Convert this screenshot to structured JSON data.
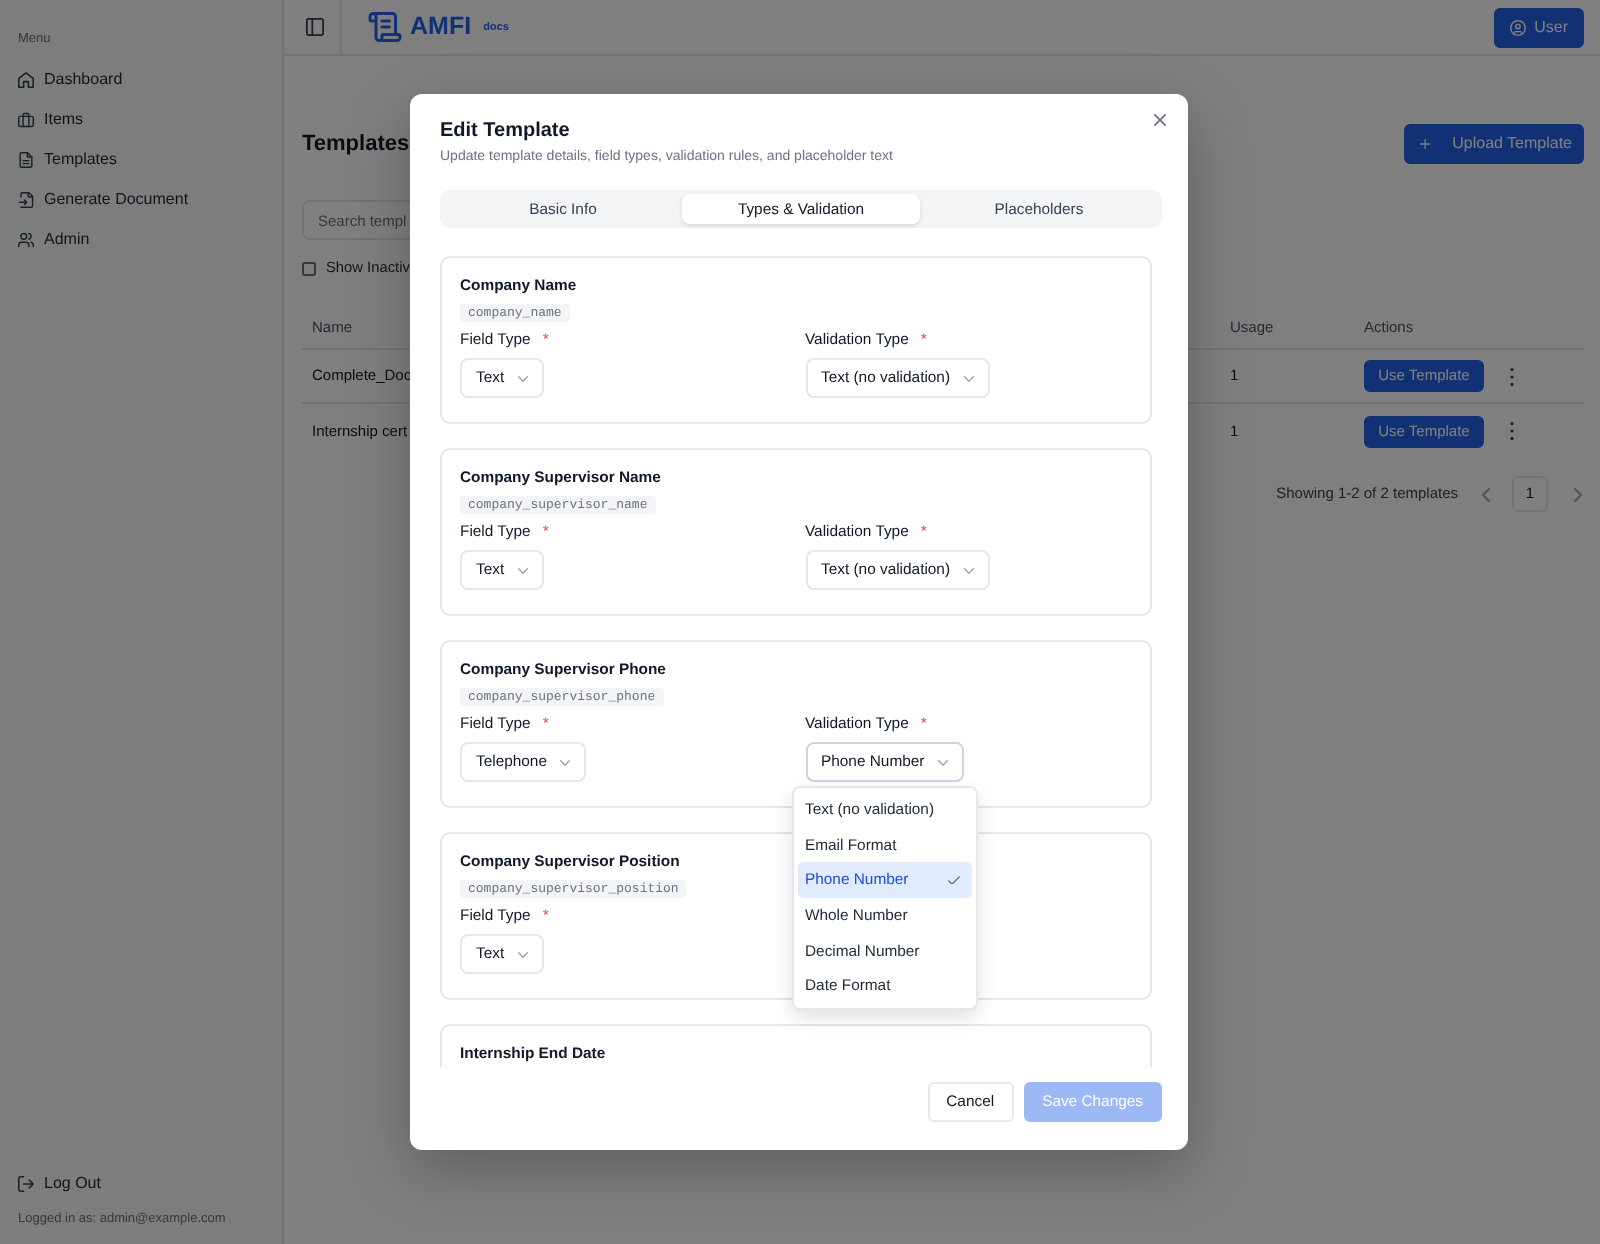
{
  "header": {
    "brand": "AMFI",
    "brand_suffix": "docs",
    "user_button": "User"
  },
  "sidebar": {
    "heading": "Menu",
    "items": [
      {
        "label": "Dashboard"
      },
      {
        "label": "Items"
      },
      {
        "label": "Templates"
      },
      {
        "label": "Generate Document"
      },
      {
        "label": "Admin"
      }
    ],
    "logout": "Log Out",
    "logged_in_as": "Logged in as: admin@example.com"
  },
  "page": {
    "title": "Templates",
    "upload_button": "Upload Template",
    "search": {
      "placeholder": "Search templ"
    },
    "show_inactive": {
      "label": "Show Inactiv",
      "checked": false
    },
    "table": {
      "columns": [
        "Name",
        "Usage",
        "Actions"
      ],
      "rows": [
        {
          "name": "Complete_Doc",
          "usage": "1",
          "action": "Use Template"
        },
        {
          "name": "Internship cert",
          "usage": "1",
          "action": "Use Template"
        }
      ]
    },
    "pagination": {
      "summary": "Showing 1-2 of 2 templates",
      "pages": [
        {
          "label": "1",
          "selected": true
        }
      ]
    }
  },
  "modal": {
    "title": "Edit Template",
    "subtitle": "Update template details, field types, validation rules, and placeholder text",
    "tabs": [
      {
        "label": "Basic Info",
        "selected": false
      },
      {
        "label": "Types & Validation",
        "selected": true
      },
      {
        "label": "Placeholders",
        "selected": false
      }
    ],
    "fields": [
      {
        "name": "Company Name",
        "key": "company_name",
        "field_type": {
          "label": "Field Type",
          "required_mark": "*",
          "value": "Text",
          "open": false
        },
        "validation_type": {
          "label": "Validation Type",
          "required_mark": "*",
          "value": "Text (no validation)",
          "open": false
        }
      },
      {
        "name": "Company Supervisor Name",
        "key": "company_supervisor_name",
        "field_type": {
          "label": "Field Type",
          "required_mark": "*",
          "value": "Text",
          "open": false
        },
        "validation_type": {
          "label": "Validation Type",
          "required_mark": "*",
          "value": "Text (no validation)",
          "open": false
        }
      },
      {
        "name": "Company Supervisor Phone",
        "key": "company_supervisor_phone",
        "field_type": {
          "label": "Field Type",
          "required_mark": "*",
          "value": "Telephone",
          "open": false
        },
        "validation_type": {
          "label": "Validation Type",
          "required_mark": "*",
          "value": "Phone Number",
          "open": true,
          "options": [
            {
              "label": "Text (no validation)",
              "selected": false
            },
            {
              "label": "Email Format",
              "selected": false
            },
            {
              "label": "Phone Number",
              "selected": true
            },
            {
              "label": "Whole Number",
              "selected": false
            },
            {
              "label": "Decimal Number",
              "selected": false
            },
            {
              "label": "Date Format",
              "selected": false
            }
          ]
        }
      },
      {
        "name": "Company Supervisor Position",
        "key": "company_supervisor_position",
        "field_type": {
          "label": "Field Type",
          "required_mark": "*",
          "value": "Text",
          "open": false
        }
      },
      {
        "name": "Internship End Date"
      }
    ],
    "buttons": [
      {
        "label": "Cancel",
        "kind": "secondary",
        "disabled": false
      },
      {
        "label": "Save Changes",
        "kind": "primary",
        "disabled": true
      }
    ]
  }
}
